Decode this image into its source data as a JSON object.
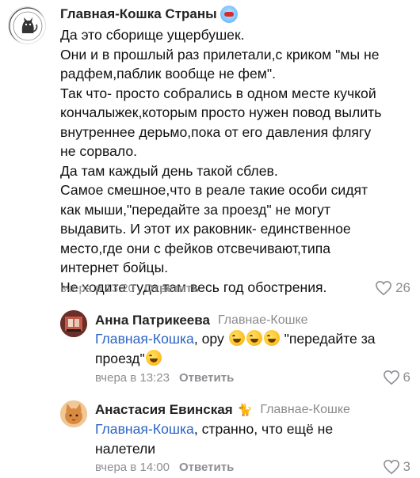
{
  "comments": [
    {
      "author": "Главная-Кошка Страны",
      "lines": [
        "Да это сборище ущербушек.",
        "Они и в прошлый раз прилетали,с криком \"мы не",
        "радфем,паблик вообще не фем\".",
        "Так что- просто собрались в одном месте кучкой",
        "кончалыжек,которым просто нужен повод вылить",
        "внутреннее дерьмо,пока от его давления флягу",
        "не сорвало.",
        "Да там каждый день такой сблев.",
        "Самое смешное,что в реале такие особи сидят",
        "как мыши,\"передайте за проезд\" не могут",
        "выдавить. И этот их раковник- единственное",
        "место,где они с фейков отсвечивают,типа",
        "интернет бойцы.",
        "Не ходите туда,там весь год обострения."
      ],
      "time": "вчера в 13:20",
      "reply_label": "Ответить",
      "likes": "26"
    },
    {
      "author": "Анна Патрикеева",
      "reply_to": "Главнае-Кошке",
      "mention": "Главная-Кошка",
      "text_a": ", ору",
      "text_b": "\"передайте за",
      "text_c": "проезд\"",
      "time": "вчера в 13:23",
      "reply_label": "Ответить",
      "likes": "6"
    },
    {
      "author": "Анастасия Евинская",
      "reply_to": "Главнае-Кошке",
      "mention": "Главная-Кошка",
      "text_a": ", странно, что ещё не",
      "text_b": "налетели",
      "time": "вчера в 14:00",
      "reply_label": "Ответить",
      "likes": "3"
    }
  ],
  "icons": {
    "heart": "heart-icon",
    "verified_badge": "badge-icon",
    "cat": "cat-icon"
  },
  "colors": {
    "mention": "#2a63c6",
    "meta": "#8e8e93"
  }
}
